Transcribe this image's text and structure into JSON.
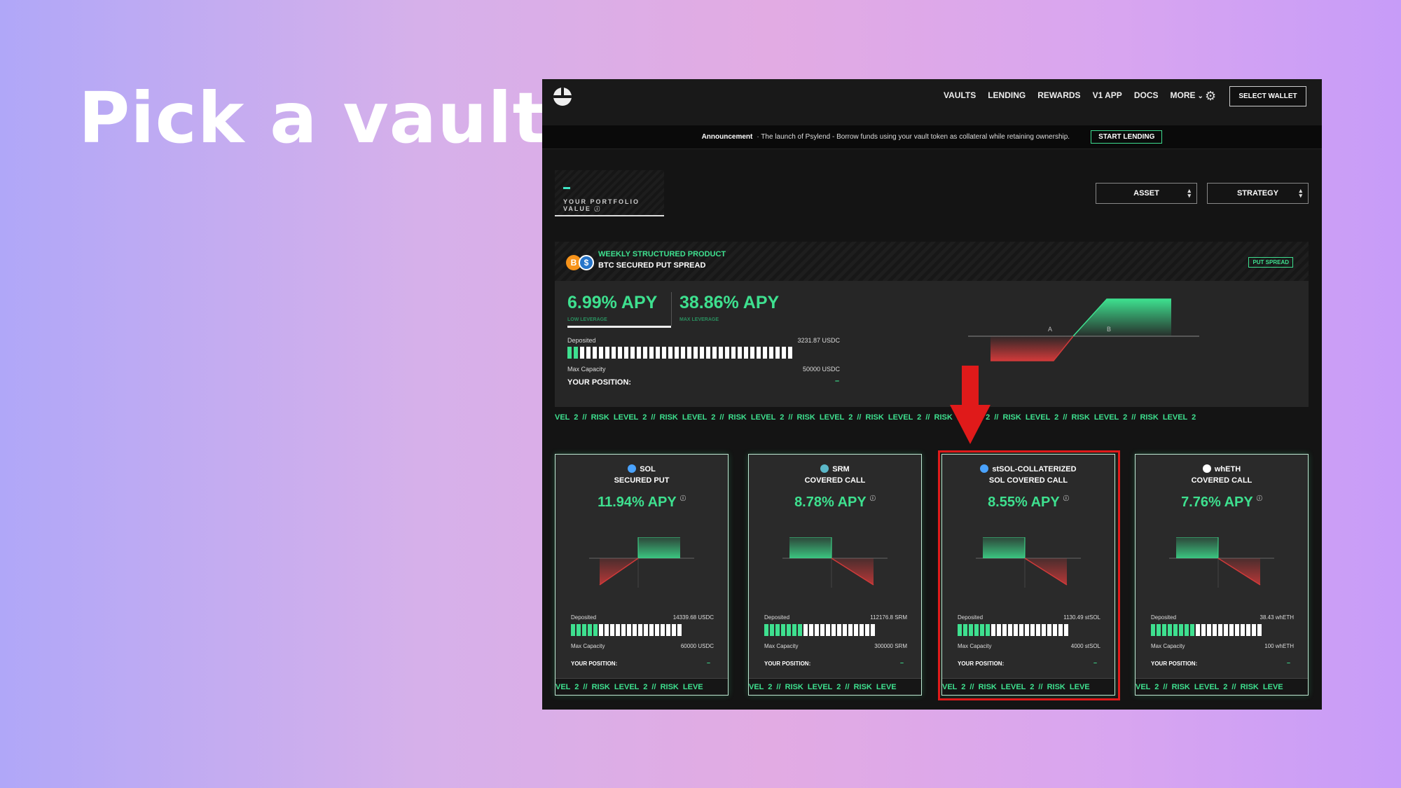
{
  "slide": {
    "title": "Pick a vault"
  },
  "nav": {
    "links": [
      "VAULTS",
      "LENDING",
      "REWARDS",
      "V1 APP",
      "DOCS",
      "MORE"
    ],
    "wallet_label": "SELECT WALLET"
  },
  "announcement": {
    "label": "Announcement",
    "text": "· The launch of Psylend - Borrow funds using your vault token as collateral while retaining ownership.",
    "button": "START LENDING"
  },
  "portfolio": {
    "label": "YOUR PORTFOLIO VALUE",
    "value": "–"
  },
  "filters": {
    "asset": "ASSET",
    "strategy": "STRATEGY"
  },
  "featured": {
    "title": "WEEKLY STRUCTURED PRODUCT",
    "subtitle": "BTC SECURED PUT SPREAD",
    "badge": "PUT SPREAD",
    "apy_low": "6.99% APY",
    "apy_low_label": "LOW LEVERAGE",
    "apy_high": "38.86% APY",
    "apy_high_label": "MAX LEVERAGE",
    "deposited_label": "Deposited",
    "deposited_value": "3231.87 USDC",
    "capacity_label": "Max Capacity",
    "capacity_value": "50000 USDC",
    "fill_fraction": 0.065,
    "position_label": "YOUR POSITION:",
    "position_value": "–",
    "payoff_marks": [
      "A",
      "B"
    ]
  },
  "ticker_text": "VEL 2  //  RISK LEVEL 2  //  RISK LEVEL 2  //  RISK LEVEL 2  //  RISK LEVEL 2  //  RISK LEVEL 2  //  RISK LEVEL 2  //  RISK LEVEL 2  //  RISK LEVEL 2  //  RISK LEVEL 2",
  "card_ticker_text": "VEL 2  //  RISK LEVEL 2  //  RISK LEVE",
  "cards": [
    {
      "asset": "SOL",
      "strategy": "SECURED PUT",
      "apy": "11.94% APY",
      "deposited_label": "Deposited",
      "deposited": "14339.68 USDC",
      "capacity_label": "Max Capacity",
      "capacity": "60000 USDC",
      "fill_fraction": 0.24,
      "position_label": "YOUR POSITION:",
      "position": "–",
      "icon_color": "#4aa3ff",
      "payoff": "put"
    },
    {
      "asset": "SRM",
      "strategy": "COVERED CALL",
      "apy": "8.78% APY",
      "deposited_label": "Deposited",
      "deposited": "112176.8 SRM",
      "capacity_label": "Max Capacity",
      "capacity": "300000 SRM",
      "fill_fraction": 0.37,
      "position_label": "YOUR POSITION:",
      "position": "–",
      "icon_color": "#5bb8c9",
      "payoff": "call"
    },
    {
      "asset": "stSOL-COLLATERIZED",
      "strategy": "SOL COVERED CALL",
      "apy": "8.55% APY",
      "deposited_label": "Deposited",
      "deposited": "1130.49 stSOL",
      "capacity_label": "Max Capacity",
      "capacity": "4000 stSOL",
      "fill_fraction": 0.28,
      "position_label": "YOUR POSITION:",
      "position": "–",
      "icon_color": "#4aa3ff",
      "payoff": "call"
    },
    {
      "asset": "whETH",
      "strategy": "COVERED CALL",
      "apy": "7.76% APY",
      "deposited_label": "Deposited",
      "deposited": "38.43 whETH",
      "capacity_label": "Max Capacity",
      "capacity": "100 whETH",
      "fill_fraction": 0.38,
      "position_label": "YOUR POSITION:",
      "position": "–",
      "icon_color": "#ffffff",
      "payoff": "call"
    }
  ],
  "colors": {
    "accent": "#3ee08f",
    "loss": "#c0392b",
    "highlight": "#e01a1a",
    "background": "#141414"
  },
  "icons": [
    "psyfi-logo-icon",
    "gear-icon",
    "chevron-down-icon",
    "info-icon",
    "btc-icon",
    "usdc-icon",
    "sol-icon",
    "srm-icon",
    "eth-icon",
    "down-arrow-icon"
  ]
}
